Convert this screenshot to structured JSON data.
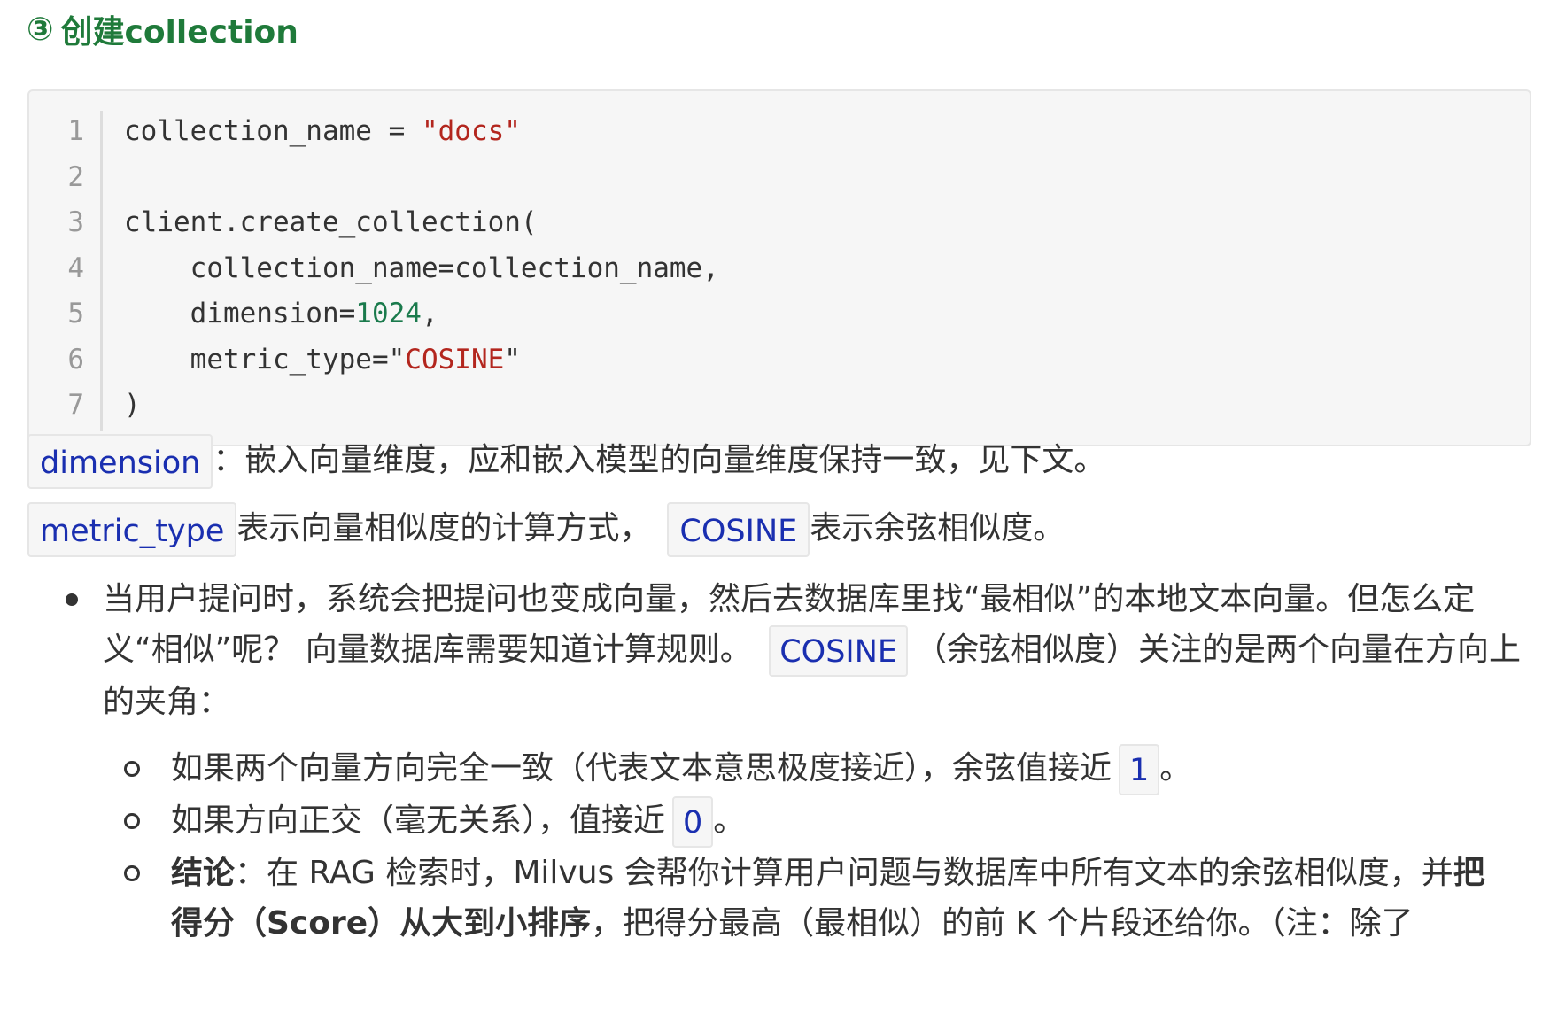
{
  "heading": {
    "number": "③",
    "title": "创建collection"
  },
  "code": {
    "line_numbers": [
      "1",
      "2",
      "3",
      "4",
      "5",
      "6",
      "7"
    ],
    "line1": {
      "var": "collection_name = ",
      "str": "\"docs\""
    },
    "line3": "client.create_collection(",
    "line4": "    collection_name=collection_name,",
    "line5": {
      "key": "    dimension=",
      "num": "1024",
      "tail": ","
    },
    "line6": {
      "key": "    metric_type=",
      "str_q1": "\"",
      "str": "COSINE",
      "str_q2": "\""
    },
    "line7": ")"
  },
  "prose": {
    "p1": {
      "code": "dimension",
      "text": "：嵌入向量维度，应和嵌入模型的向量维度保持一致，见下文。"
    },
    "p2": {
      "code1": "metric_type",
      "text1": "表示向量相似度的计算方式，",
      "code2": "COSINE",
      "text2": "表示余弦相似度。"
    }
  },
  "bullets": {
    "b1": {
      "text1": "当用户提问时，系统会把提问也变成向量，然后去数据库里找“最相似”的本地文本向量。但怎么定",
      "text2": "义“相似”呢？ 向量数据库需要知道计算规则。",
      "code": "COSINE",
      "text3": "（余弦相似度）关注的是两个向量在方向上",
      "text4": "的夹角："
    },
    "sub1": {
      "text": "如果两个向量方向完全一致（代表文本意思极度接近），余弦值接近",
      "code": "1",
      "tail": "。"
    },
    "sub2": {
      "text": "如果方向正交（毫无关系），值接近",
      "code": "0",
      "tail": "。"
    },
    "sub3": {
      "bold1": "结论",
      "text1": "：在 RAG 检索时，Milvus 会帮你计算用户问题与数据库中所有文本的余弦相似度，并",
      "bold2": "把",
      "bold3": "得分（Score）从大到小排序",
      "text2": "，把得分最高（最相似）的前 K 个片段还给你。（注：除了"
    }
  }
}
